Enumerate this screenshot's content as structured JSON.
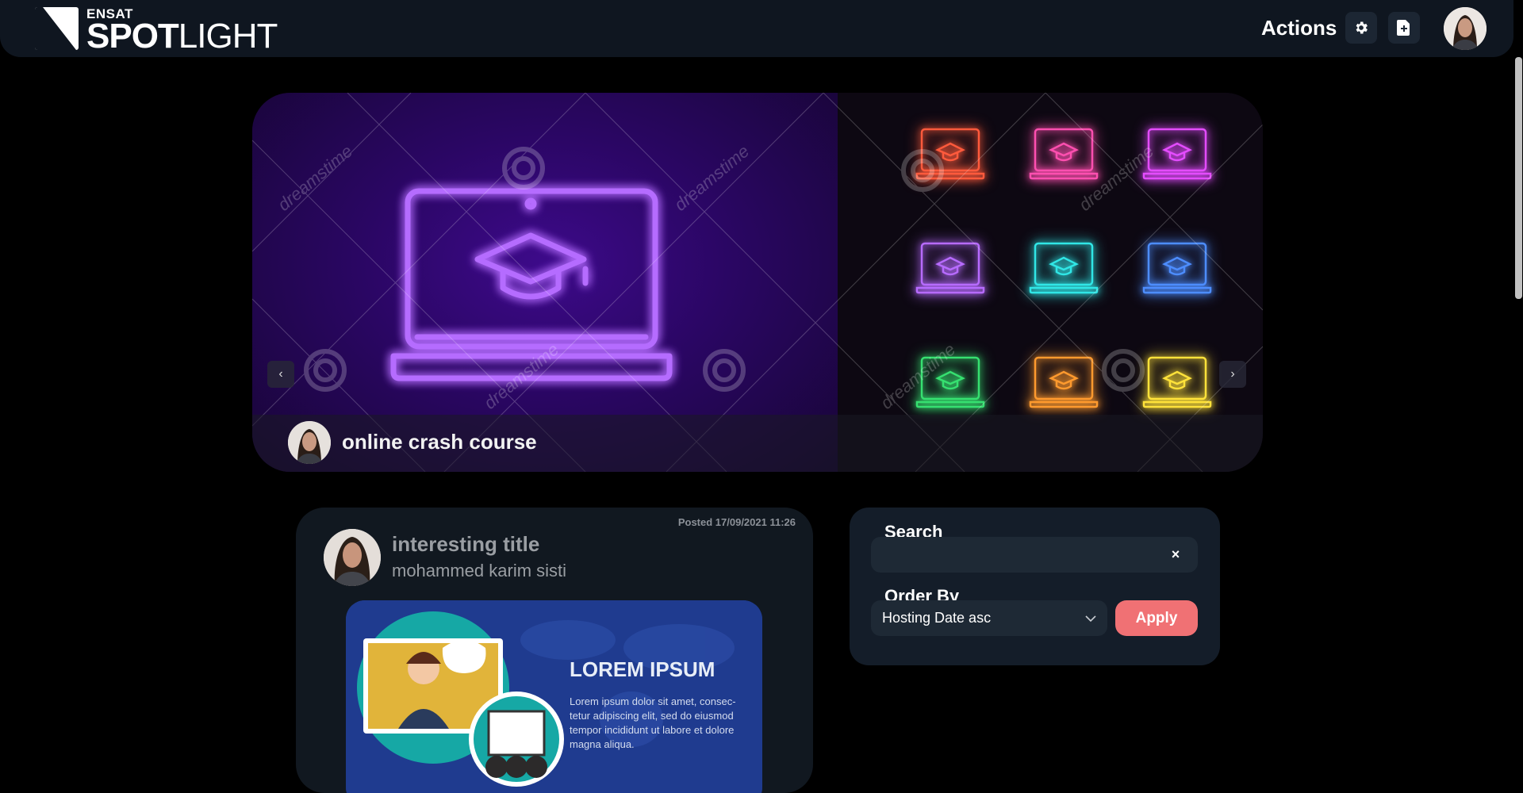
{
  "brand": {
    "small": "ENSAT",
    "big_bold": "SPOT",
    "big_light": "LIGHT"
  },
  "navbar": {
    "actions_label": "Actions",
    "settings_icon": "gear-icon",
    "add_icon": "add-file-icon"
  },
  "carousel": {
    "slide_title": "online crash course",
    "prev_icon": "chevron-left-icon",
    "next_icon": "chevron-right-icon",
    "prev_glyph": "‹",
    "next_glyph": "›",
    "watermark": "dreamstime",
    "neon_colors": [
      "#ff5a3c",
      "#ff4fb0",
      "#e44cff",
      "#b76bff",
      "#30e6e6",
      "#4d8dff",
      "#36e070",
      "#ff9a2e",
      "#ffe23a"
    ],
    "main_neon": "#a24bff"
  },
  "post": {
    "date": "Posted 17/09/2021 11:26",
    "title": "interesting title",
    "author": "mohammed karim sisti",
    "image_heading": "LOREM IPSUM",
    "image_text": "Lorem ipsum dolor sit amet, consec-\ntetur adipiscing elit, sed do eiusmod\ntempor incididunt ut labore et dolore\nmagna aliqua."
  },
  "filter": {
    "search_label": "Search",
    "search_value": "",
    "clear_glyph": "×",
    "order_label": "Order By",
    "order_value": "Hosting Date asc",
    "apply_label": "Apply",
    "apply_color": "#f07174"
  }
}
